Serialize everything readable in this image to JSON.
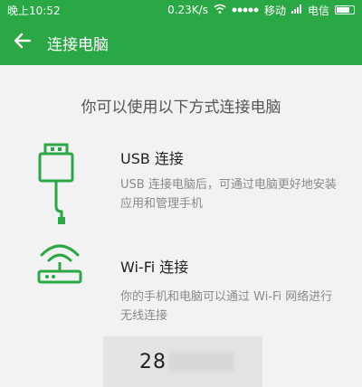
{
  "status_bar": {
    "time": "晚上10:52",
    "speed": "0.23K/s",
    "carrier": "移动",
    "carrier2": "电信"
  },
  "app_bar": {
    "title": "连接电脑"
  },
  "prompt": "你可以使用以下方式连接电脑",
  "options": [
    {
      "title": "USB 连接",
      "description": "USB 连接电脑后，可通过电脑更好地安装应用和管理手机"
    },
    {
      "title": "Wi-Fi 连接",
      "description": "你的手机和电脑可以通过 Wi-Fi 网络进行无线连接"
    }
  ],
  "code": {
    "visible_prefix": "28"
  },
  "colors": {
    "brand_green": "#2aa845",
    "background": "#f2f2f2"
  }
}
